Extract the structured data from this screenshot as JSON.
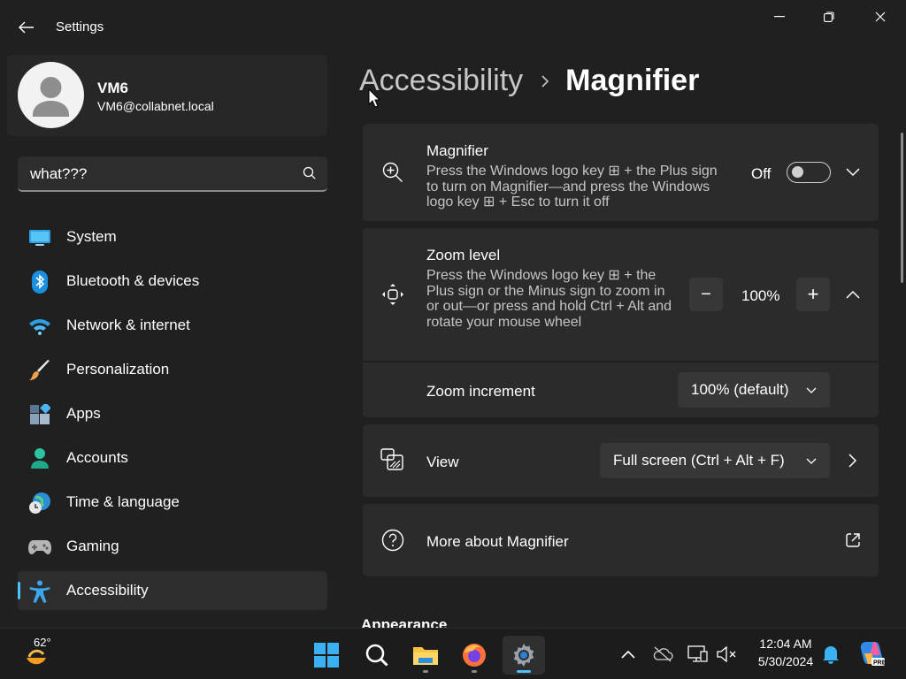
{
  "window": {
    "app_title": "Settings"
  },
  "user": {
    "name": "VM6",
    "email": "VM6@collabnet.local"
  },
  "search": {
    "value": "what???"
  },
  "nav": {
    "items": [
      {
        "label": "System",
        "icon": "system-icon"
      },
      {
        "label": "Bluetooth & devices",
        "icon": "bluetooth-icon"
      },
      {
        "label": "Network & internet",
        "icon": "wifi-icon"
      },
      {
        "label": "Personalization",
        "icon": "brush-icon"
      },
      {
        "label": "Apps",
        "icon": "apps-icon"
      },
      {
        "label": "Accounts",
        "icon": "accounts-icon"
      },
      {
        "label": "Time & language",
        "icon": "time-language-icon"
      },
      {
        "label": "Gaming",
        "icon": "gamepad-icon"
      },
      {
        "label": "Accessibility",
        "icon": "accessibility-icon"
      }
    ],
    "active": "Accessibility"
  },
  "breadcrumb": {
    "parent": "Accessibility",
    "current": "Magnifier"
  },
  "magnifier": {
    "title": "Magnifier",
    "description": "Press the Windows logo key ⊞ + the Plus sign to turn on Magnifier—and press the Windows logo key ⊞ + Esc to turn it off",
    "toggle_state": "Off",
    "enabled": false
  },
  "zoom": {
    "title": "Zoom level",
    "description": "Press the Windows logo key ⊞ + the Plus sign or the Minus sign to zoom in or out—or press and hold Ctrl + Alt and rotate your mouse wheel",
    "value": "100%",
    "minus_symbol": "−",
    "plus_symbol": "+",
    "increment_label": "Zoom increment",
    "increment_value": "100% (default)"
  },
  "view": {
    "label": "View",
    "value": "Full screen (Ctrl + Alt + F)"
  },
  "more": {
    "label": "More about Magnifier"
  },
  "appearance": {
    "title": "Appearance"
  },
  "taskbar": {
    "weather_temp": "62°",
    "clock_time": "12:04 AM",
    "clock_date": "5/30/2024"
  },
  "colors": {
    "accent": "#4cc2ff",
    "background": "#202020",
    "card": "#2b2b2b"
  }
}
